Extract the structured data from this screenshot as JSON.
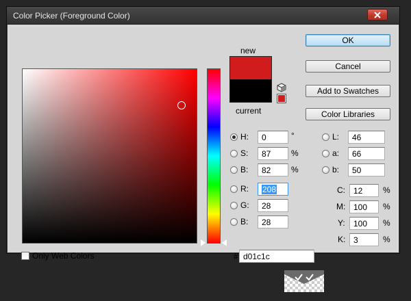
{
  "window": {
    "title": "Color Picker (Foreground Color)"
  },
  "swatches": {
    "new_label": "new",
    "current_label": "current",
    "new_color": "#d01c1c",
    "current_color": "#000000"
  },
  "buttons": {
    "ok": "OK",
    "cancel": "Cancel",
    "add_to_swatches": "Add to Swatches",
    "color_libraries": "Color Libraries"
  },
  "hsb": {
    "h": {
      "label": "H:",
      "value": "0",
      "unit": "°",
      "selected": true
    },
    "s": {
      "label": "S:",
      "value": "87",
      "unit": "%"
    },
    "b": {
      "label": "B:",
      "value": "82",
      "unit": "%"
    }
  },
  "rgb": {
    "r": {
      "label": "R:",
      "value": "208"
    },
    "g": {
      "label": "G:",
      "value": "28"
    },
    "b": {
      "label": "B:",
      "value": "28"
    }
  },
  "lab": {
    "l": {
      "label": "L:",
      "value": "46"
    },
    "a": {
      "label": "a:",
      "value": "66"
    },
    "b": {
      "label": "b:",
      "value": "50"
    }
  },
  "cmyk": {
    "c": {
      "label": "C:",
      "value": "12",
      "unit": "%"
    },
    "m": {
      "label": "M:",
      "value": "100",
      "unit": "%"
    },
    "y": {
      "label": "Y:",
      "value": "100",
      "unit": "%"
    },
    "k": {
      "label": "K:",
      "value": "3",
      "unit": "%"
    }
  },
  "hex": {
    "label": "#",
    "value": "d01c1c"
  },
  "web_colors": {
    "label": "Only Web Colors",
    "checked": false
  },
  "icons": [
    "close-icon",
    "cube-icon",
    "gamut-swatch-icon",
    "chevron-icon"
  ]
}
